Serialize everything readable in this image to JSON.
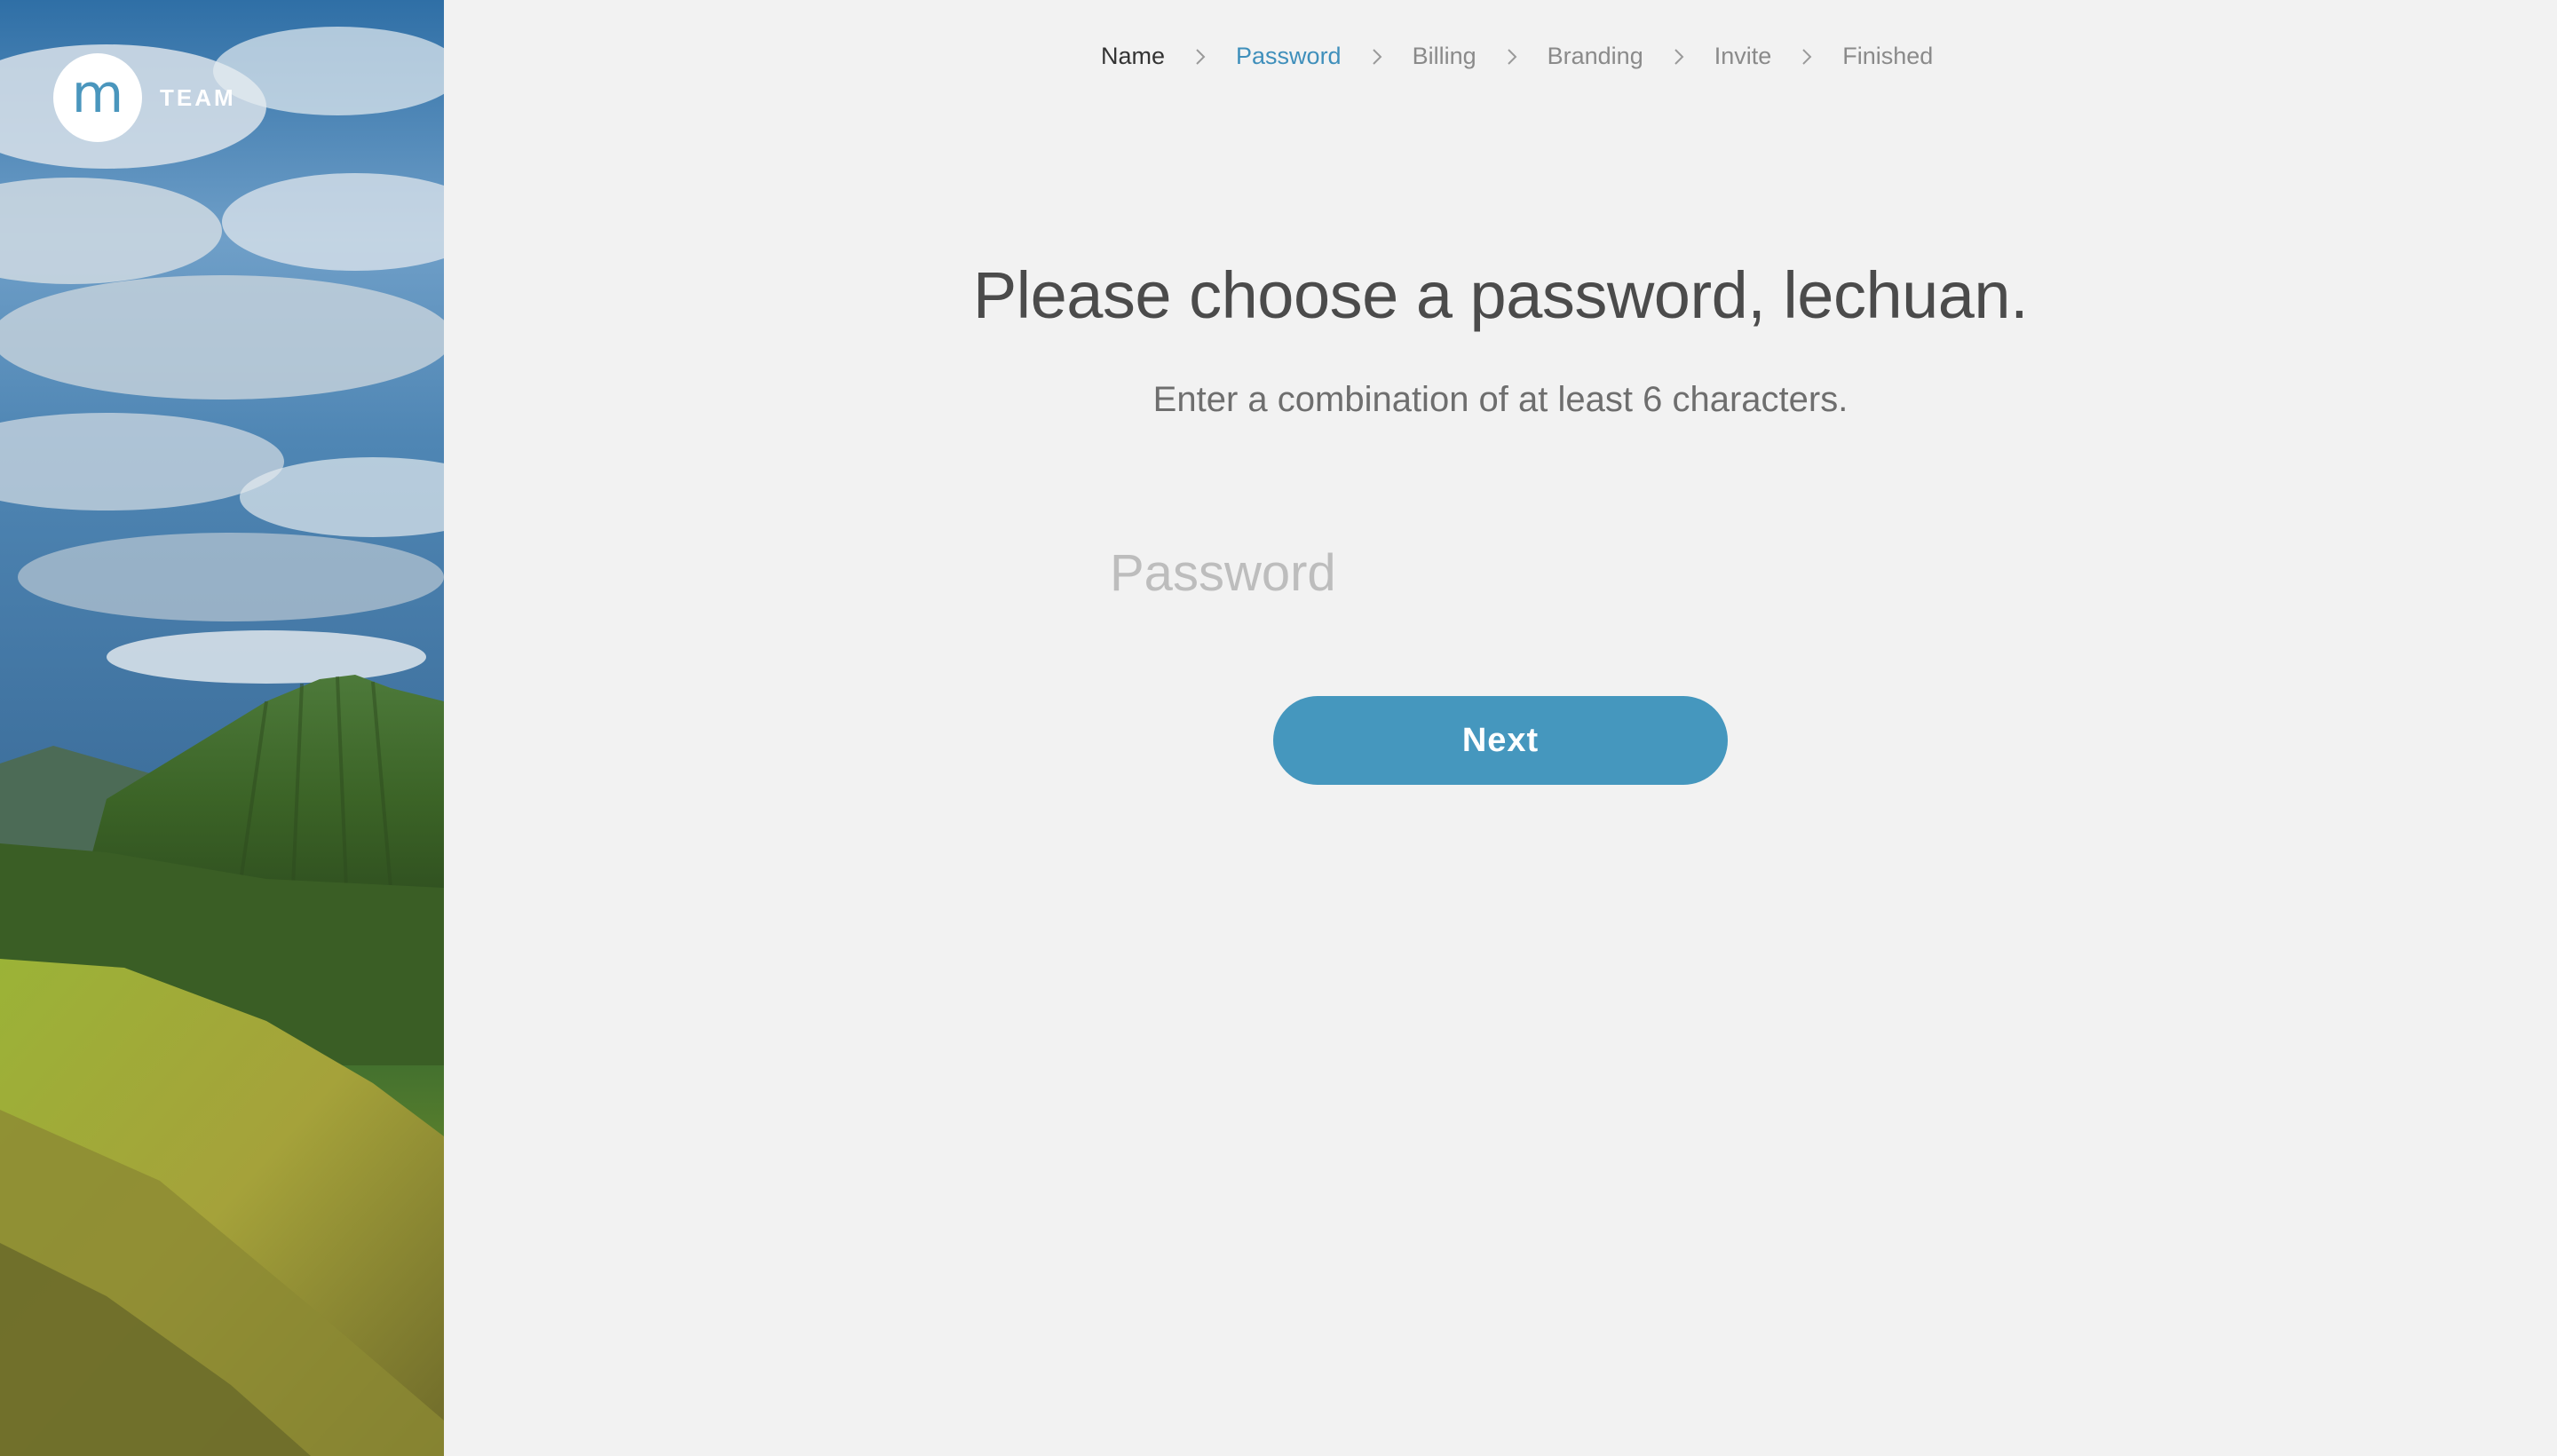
{
  "brand": {
    "logo_letter": "m",
    "name": "TEAM"
  },
  "steps": [
    {
      "label": "Name",
      "state": "done"
    },
    {
      "label": "Password",
      "state": "current"
    },
    {
      "label": "Billing",
      "state": "upcoming"
    },
    {
      "label": "Branding",
      "state": "upcoming"
    },
    {
      "label": "Invite",
      "state": "upcoming"
    },
    {
      "label": "Finished",
      "state": "upcoming"
    }
  ],
  "form": {
    "title": "Please choose a password, lechuan.",
    "subtitle": "Enter a combination of at least 6 characters.",
    "password_placeholder": "Password",
    "password_value": "",
    "next_label": "Next"
  },
  "colors": {
    "accent": "#4597be",
    "current_step": "#3f8fbb",
    "background": "#f2f2f2"
  },
  "icons": {
    "step_separator": "chevron-right-icon"
  }
}
